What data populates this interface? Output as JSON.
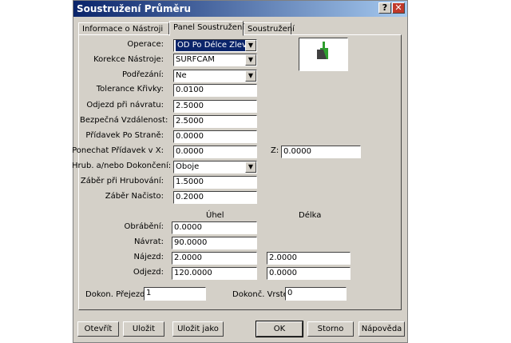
{
  "window": {
    "title": "Soustružení Průměru",
    "help_btn": "?",
    "close_btn": "✕"
  },
  "tabs": [
    {
      "label": "Informace o Nástroji"
    },
    {
      "label": "Panel Soustružení"
    },
    {
      "label": "Soustružení"
    }
  ],
  "form": {
    "operace": {
      "label": "Operace:",
      "value": "OD Po Délce Zleva"
    },
    "korekce": {
      "label": "Korekce Nástroje:",
      "value": "SURFCAM"
    },
    "podrezani": {
      "label": "Podřezání:",
      "value": "Ne"
    },
    "tolerance": {
      "label": "Tolerance Křivky:",
      "value": "0.0100"
    },
    "odjezd_navrat": {
      "label": "Odjezd při návratu:",
      "value": "2.5000"
    },
    "bezpecna": {
      "label": "Bezpečná Vzdálenost:",
      "value": "2.5000"
    },
    "pridavek": {
      "label": "Přídavek Po Straně:",
      "value": "0.0000"
    },
    "ponechat_x": {
      "label": "Ponechat Přídavek v X:",
      "value": "0.0000"
    },
    "ponechat_z": {
      "label": "Z:",
      "value": "0.0000"
    },
    "hrub": {
      "label": "Hrub. a/nebo Dokončení:",
      "value": "Oboje"
    },
    "zaber_hrub": {
      "label": "Záběr při Hrubování:",
      "value": "1.5000"
    },
    "zaber_nacisto": {
      "label": "Záběr Načisto:",
      "value": "0.2000"
    }
  },
  "moves": {
    "header_uhel": "Úhel",
    "header_delka": "Délka",
    "obrabeni": {
      "label": "Obrábění:",
      "uhel": "0.0000"
    },
    "navrat": {
      "label": "Návrat:",
      "uhel": "90.0000"
    },
    "najezd": {
      "label": "Nájezd:",
      "uhel": "2.0000",
      "delka": "2.0000"
    },
    "odjezd": {
      "label": "Odjezd:",
      "uhel": "120.0000",
      "delka": "0.0000"
    }
  },
  "passes": {
    "dokon_prejezdy": {
      "label": "Dokon. Přejezdy:",
      "value": "1"
    },
    "dokonc_vrstev": {
      "label": "Dokonč. Vrstev:",
      "value": "0"
    }
  },
  "buttons": {
    "open": "Otevřít",
    "save": "Uložit",
    "save_as": "Uložit jako",
    "ok": "OK",
    "cancel": "Storno",
    "help": "Nápověda"
  },
  "colors": {
    "titlebar_start": "#0a246a",
    "titlebar_end": "#a6caf0",
    "dialog_bg": "#d4d0c8",
    "tool_green": "#2e9e2e"
  },
  "icons": {
    "preview": "lathe-tool-icon",
    "dropdown": "chevron-down-icon"
  }
}
